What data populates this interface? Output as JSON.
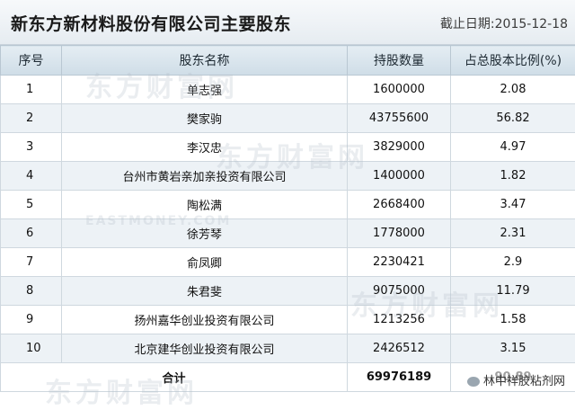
{
  "header": {
    "title": "新东方新材料股份有限公司主要股东",
    "date": "截止日期:2015-12-18"
  },
  "table": {
    "columns": [
      "序号",
      "股东名称",
      "持股数量",
      "占总股本比例(%)"
    ],
    "rows": [
      {
        "no": "1",
        "name": "单志强",
        "shares": "1600000",
        "pct": "2.08"
      },
      {
        "no": "2",
        "name": "樊家驹",
        "shares": "43755600",
        "pct": "56.82"
      },
      {
        "no": "3",
        "name": "李汉忠",
        "shares": "3829000",
        "pct": "4.97"
      },
      {
        "no": "4",
        "name": "台州市黄岩亲加亲投资有限公司",
        "shares": "1400000",
        "pct": "1.82"
      },
      {
        "no": "5",
        "name": "陶松满",
        "shares": "2668400",
        "pct": "3.47"
      },
      {
        "no": "6",
        "name": "徐芳琴",
        "shares": "1778000",
        "pct": "2.31"
      },
      {
        "no": "7",
        "name": "俞凤卿",
        "shares": "2230421",
        "pct": "2.9"
      },
      {
        "no": "8",
        "name": "朱君斐",
        "shares": "9075000",
        "pct": "11.79"
      },
      {
        "no": "9",
        "name": "扬州嘉华创业投资有限公司",
        "shares": "1213256",
        "pct": "1.58"
      },
      {
        "no": "10",
        "name": "北京建华创业投资有限公司",
        "shares": "2426512",
        "pct": "3.15"
      }
    ],
    "total": {
      "label": "合计",
      "shares": "69976189",
      "pct": "90.89"
    }
  },
  "watermark": {
    "brand": "东方财富网",
    "sub": "EASTMONEY.COM"
  },
  "wechat": {
    "label": "林中祥胶粘剂网",
    "icon": "wechat-icon"
  }
}
